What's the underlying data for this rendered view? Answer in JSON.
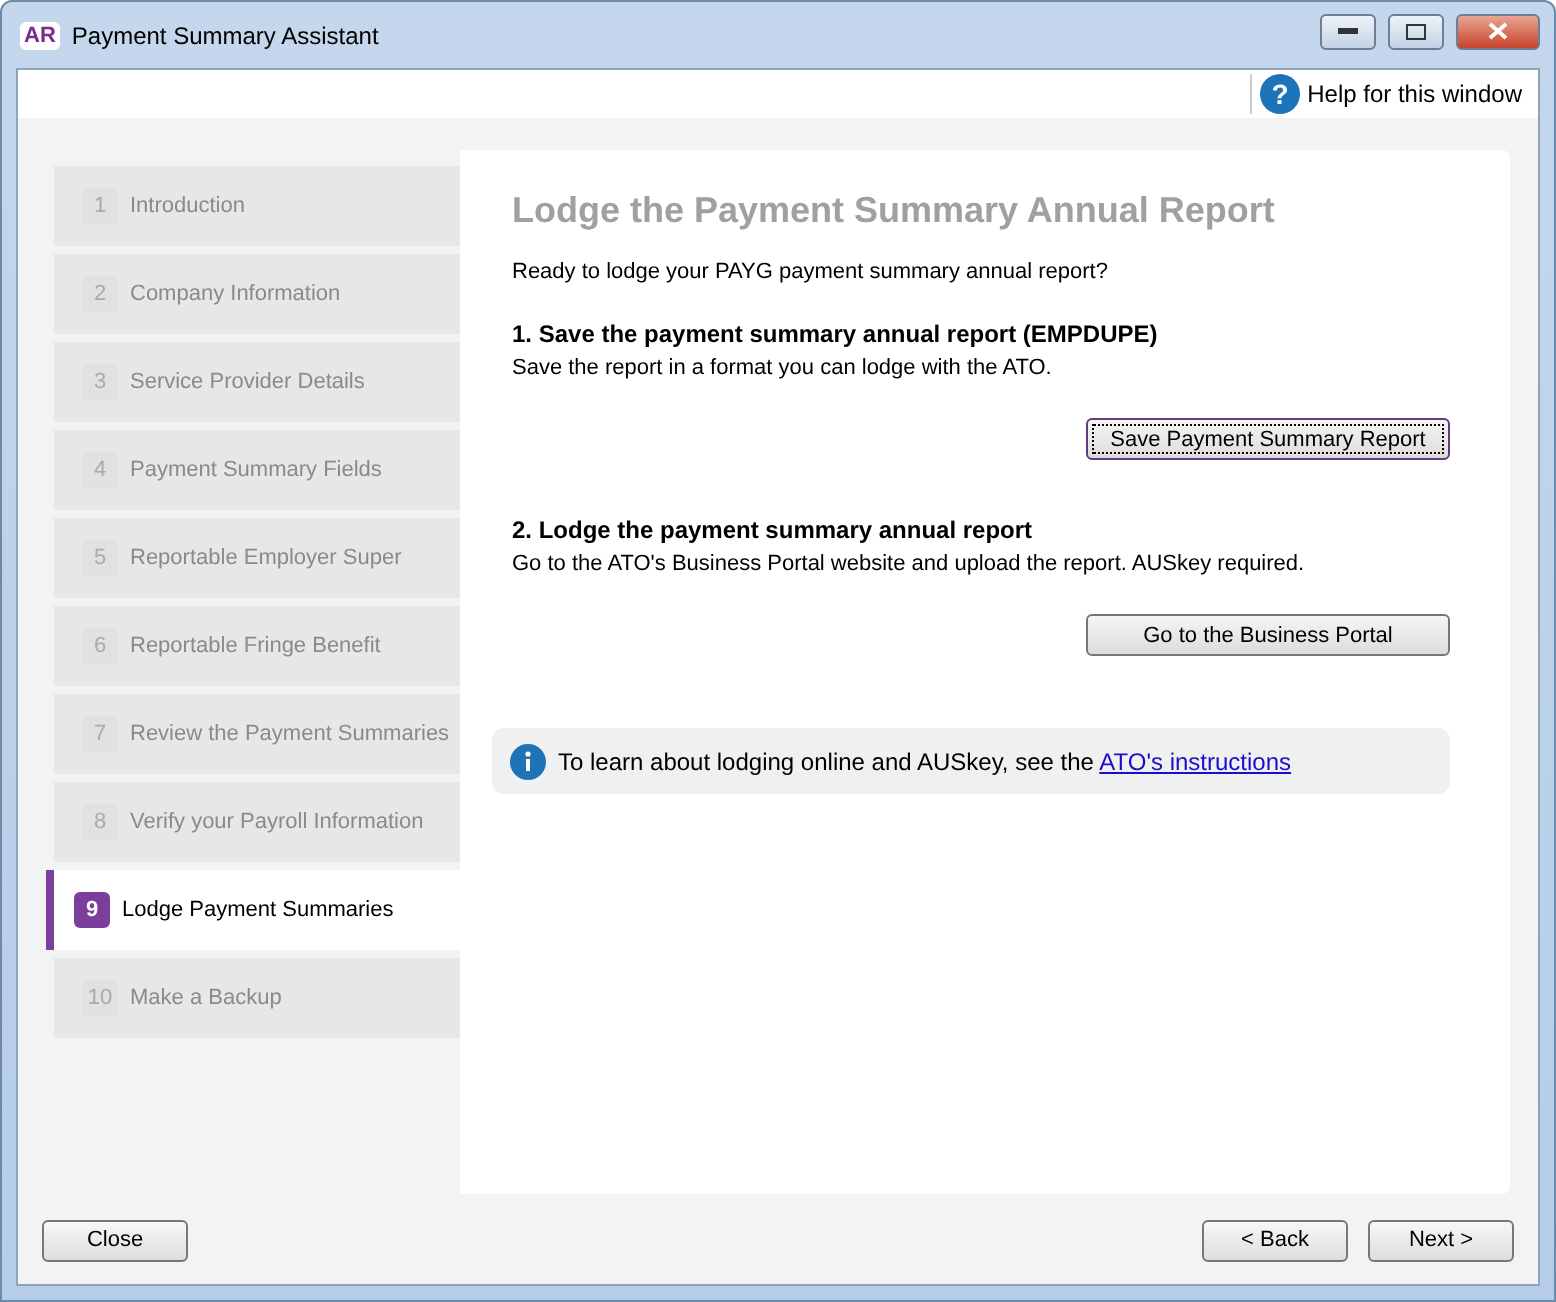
{
  "window": {
    "icon": "AR",
    "title": "Payment Summary Assistant"
  },
  "help": {
    "icon": "?",
    "label": "Help for this window"
  },
  "steps": [
    {
      "number": "1",
      "label": "Introduction",
      "selected": false
    },
    {
      "number": "2",
      "label": "Company Information",
      "selected": false
    },
    {
      "number": "3",
      "label": "Service Provider Details",
      "selected": false
    },
    {
      "number": "4",
      "label": "Payment Summary Fields",
      "selected": false
    },
    {
      "number": "5",
      "label": "Reportable Employer Super",
      "selected": false
    },
    {
      "number": "6",
      "label": "Reportable Fringe Benefit",
      "selected": false
    },
    {
      "number": "7",
      "label": "Review the Payment Summaries",
      "selected": false
    },
    {
      "number": "8",
      "label": "Verify your Payroll Information",
      "selected": false
    },
    {
      "number": "9",
      "label": "Lodge Payment Summaries",
      "selected": true
    },
    {
      "number": "10",
      "label": "Make a Backup",
      "selected": false
    }
  ],
  "page": {
    "heading": "Lodge the Payment Summary Annual Report",
    "intro": "Ready to lodge your PAYG payment summary annual report?",
    "sections": [
      {
        "title": "1. Save the payment summary annual report (EMPDUPE)",
        "text": "Save the report in a format you can lodge with the ATO.",
        "button": "Save Payment Summary Report",
        "focused": true
      },
      {
        "title": "2. Lodge the payment summary annual report",
        "text": "Go to the ATO's Business Portal website and upload the report. AUSkey required.",
        "button": "Go to the Business Portal",
        "focused": false
      }
    ],
    "info": {
      "text": "To learn about lodging online and AUSkey, see the ",
      "link": "ATO's instructions"
    }
  },
  "footer": {
    "close": "Close",
    "back": "< Back",
    "next": "Next >"
  }
}
